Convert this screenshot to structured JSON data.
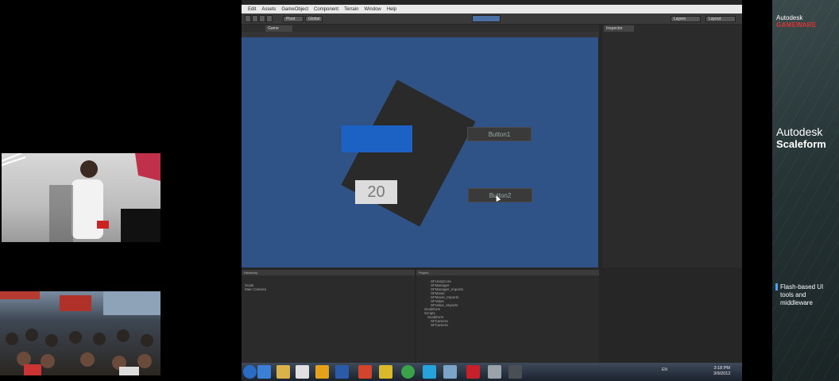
{
  "menu": [
    "Edit",
    "Assets",
    "GameObject",
    "Component",
    "Terrain",
    "Window",
    "Help"
  ],
  "toolbar": {
    "dropdowns": [
      "Pivot",
      "Global"
    ],
    "layers": "Layers",
    "layout": "Layout"
  },
  "tabs": {
    "game": "Game",
    "inspector": "Inspector"
  },
  "game_view": {
    "counter_value": "20",
    "button1_label": "Button1",
    "button2_label": "Button2"
  },
  "hierarchy": {
    "title": "Hierarchy",
    "items": [
      "Scale",
      "Main Camera"
    ]
  },
  "project": {
    "title": "Project",
    "items": [
      "SFUnityCore",
      "SFManager",
      "SFManager_Imports",
      "SFMovie",
      "SFMovie_Imports",
      "SFValue",
      "SFValue_Imports",
      "Scaleform",
      "Scripts",
      "Scaleform",
      "SFCamera",
      "SFCamera"
    ]
  },
  "taskbar": {
    "lang": "EN",
    "time": "3:18 PM",
    "date": "3/9/2012"
  },
  "branding": {
    "company": "Autodesk",
    "gameware": "GAMEWARE",
    "product_line1": "Autodesk",
    "product_line2": "Scaleform",
    "tagline": "Flash-based UI tools and middleware"
  }
}
